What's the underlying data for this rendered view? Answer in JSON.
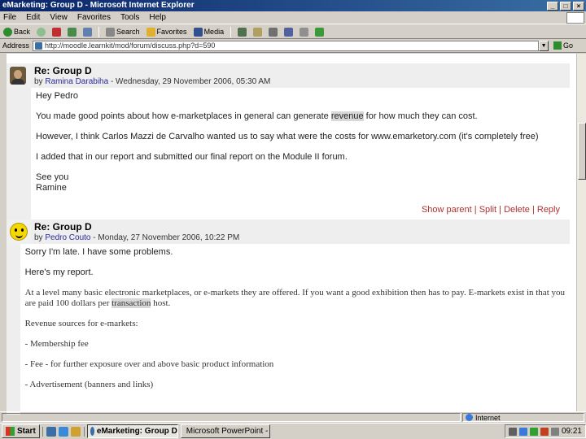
{
  "window": {
    "title": "eMarketing: Group D - Microsoft Internet Explorer",
    "min": "_",
    "max": "□",
    "close": "×"
  },
  "menu": [
    "File",
    "Edit",
    "View",
    "Favorites",
    "Tools",
    "Help"
  ],
  "toolbar": {
    "back": "Back",
    "search": "Search",
    "favorites": "Favorites",
    "media": "Media"
  },
  "address": {
    "label": "Address",
    "url": "http://moodle.learnkit/mod/forum/discuss.php?d=590",
    "go": "Go"
  },
  "colors": {
    "link": "#b03030",
    "author": "#2a2a9a"
  },
  "posts": [
    {
      "subject": "Re: Group D",
      "by": "by",
      "author": "Ramina Darabiha",
      "date": "- Wednesday, 29 November 2006, 05:30 AM",
      "avatar": "user-photo",
      "lines": {
        "l1": "Hey Pedro",
        "l2a": "You made good points about how e-marketplaces in general can generate ",
        "l2b": "revenue",
        "l2c": " for how much they can cost.",
        "l3": "However, I think Carlos Mazzi de Carvalho wanted us to say what were the costs for www.emarketory.com (it's completely free)",
        "l4": "I added that in our report and submitted our final report on the Module II forum.",
        "l5": "See you",
        "l6": "Ramine"
      },
      "links": {
        "show_parent": "Show parent",
        "split": "Split",
        "delete": "Delete",
        "reply": "Reply",
        "sep": " | "
      }
    },
    {
      "subject": "Re: Group D",
      "by": "by",
      "author": "Pedro Couto",
      "date": "- Monday, 27 November 2006, 10:22 PM",
      "avatar": "smiley-icon",
      "lines": {
        "l1": "Sorry I'm late. I have some problems.",
        "l2": "Here's my report.",
        "l3a": "At a level many basic electronic marketplaces, or e-markets they are offered. If you want a good exhibition then has to pay. E-markets exist in that you",
        "l3b": "are paid 100 dollars per ",
        "l3c": "transaction",
        "l3d": " host.",
        "l4": "Revenue sources for e-markets:",
        "l5": "- Membership fee",
        "l6": "- Fee - for further exposure over and above basic product information",
        "l7": "- Advertisement (banners and links)"
      }
    }
  ],
  "status": {
    "zone": "Internet"
  },
  "taskbar": {
    "start": "Start",
    "task1": "eMarketing: Group D",
    "task2": "Microsoft PowerPoint - [Ak...",
    "clock": "09:21"
  }
}
